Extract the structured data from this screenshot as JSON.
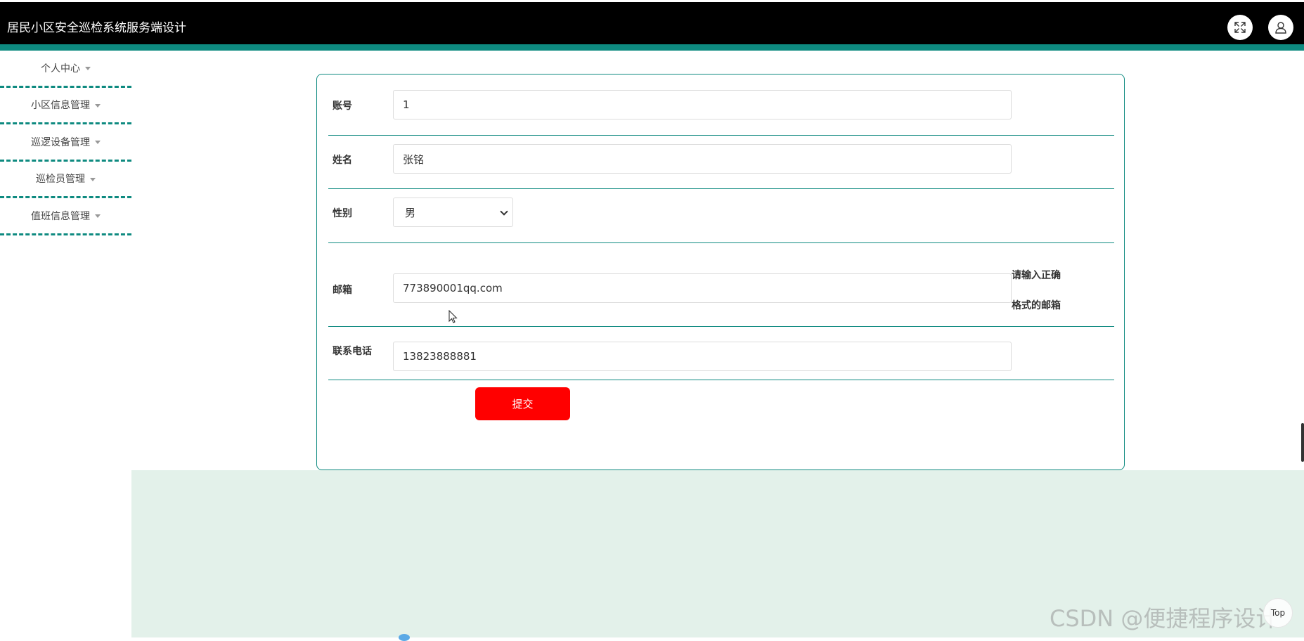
{
  "header": {
    "title": "居民小区安全巡检系统服务端设计",
    "bg_color": "#000000",
    "accent_color": "#0e8a80",
    "fullscreen_icon": "expand-icon",
    "user_icon": "user-icon"
  },
  "sidebar": {
    "items": [
      {
        "label": "个人中心"
      },
      {
        "label": "小区信息管理"
      },
      {
        "label": "巡逻设备管理"
      },
      {
        "label": "巡检员管理"
      },
      {
        "label": "值班信息管理"
      }
    ]
  },
  "form": {
    "account": {
      "label": "账号",
      "value": "1"
    },
    "name": {
      "label": "姓名",
      "value": "张铭"
    },
    "gender": {
      "label": "性别",
      "value": "男"
    },
    "email": {
      "label": "邮箱",
      "value": "773890001qq.com",
      "hint_line1": "请输入正确",
      "hint_line2": "格式的邮箱"
    },
    "phone": {
      "label": "联系电话",
      "value": "13823888881"
    },
    "submit_label": "提交",
    "submit_color": "#ff0000"
  },
  "watermark": "CSDN @便捷程序设计",
  "top_button": "Top"
}
